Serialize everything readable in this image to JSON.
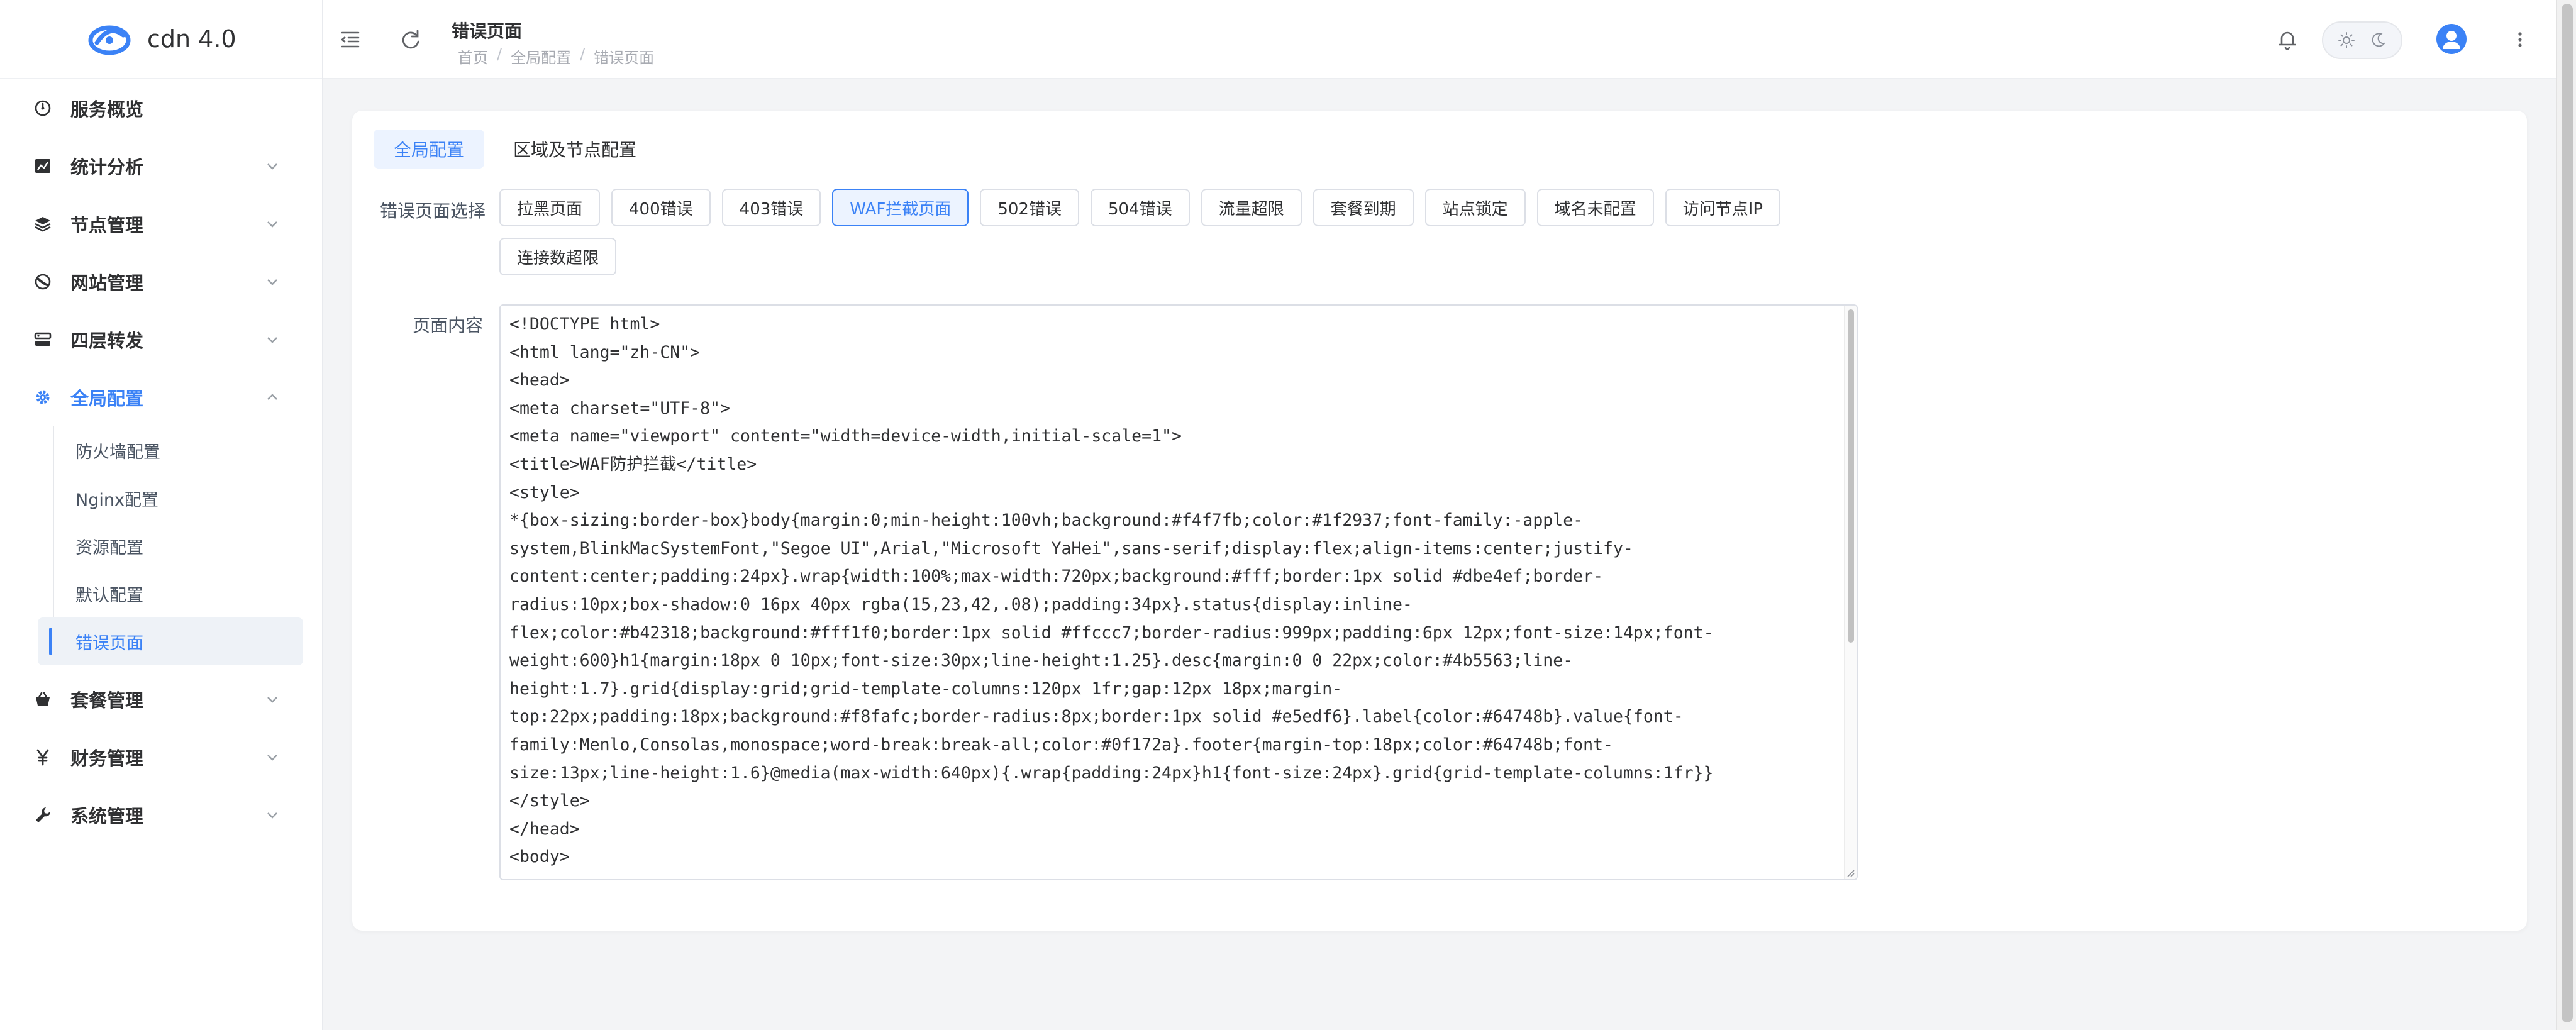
{
  "app": {
    "name": "cdn 4.0"
  },
  "sidebar": {
    "items": [
      {
        "label": "服务概览",
        "icon": "dashboard-icon",
        "has_children": false
      },
      {
        "label": "统计分析",
        "icon": "chart-icon",
        "has_children": true
      },
      {
        "label": "节点管理",
        "icon": "layers-icon",
        "has_children": true
      },
      {
        "label": "网站管理",
        "icon": "globe-icon",
        "has_children": true
      },
      {
        "label": "四层转发",
        "icon": "server-icon",
        "has_children": true
      },
      {
        "label": "全局配置",
        "icon": "gear-icon",
        "has_children": true,
        "expanded": true,
        "children": [
          {
            "label": "防火墙配置"
          },
          {
            "label": "Nginx配置"
          },
          {
            "label": "资源配置"
          },
          {
            "label": "默认配置"
          },
          {
            "label": "错误页面",
            "active": true
          }
        ]
      },
      {
        "label": "套餐管理",
        "icon": "basket-icon",
        "has_children": true
      },
      {
        "label": "财务管理",
        "icon": "yen-icon",
        "has_children": true
      },
      {
        "label": "系统管理",
        "icon": "wrench-icon",
        "has_children": true
      }
    ]
  },
  "header": {
    "title": "错误页面",
    "breadcrumb": [
      "首页",
      "全局配置",
      "错误页面"
    ],
    "separator": "/"
  },
  "tabs": [
    {
      "label": "全局配置",
      "active": true
    },
    {
      "label": "区域及节点配置",
      "active": false
    }
  ],
  "form": {
    "error_page_label": "错误页面选择",
    "content_label": "页面内容",
    "error_pages": [
      {
        "label": "拉黑页面",
        "active": false
      },
      {
        "label": "400错误",
        "active": false
      },
      {
        "label": "403错误",
        "active": false
      },
      {
        "label": "WAF拦截页面",
        "active": true
      },
      {
        "label": "502错误",
        "active": false
      },
      {
        "label": "504错误",
        "active": false
      },
      {
        "label": "流量超限",
        "active": false
      },
      {
        "label": "套餐到期",
        "active": false
      },
      {
        "label": "站点锁定",
        "active": false
      },
      {
        "label": "域名未配置",
        "active": false
      },
      {
        "label": "访问节点IP",
        "active": false
      },
      {
        "label": "连接数超限",
        "active": false
      }
    ],
    "code_lines": [
      "<!DOCTYPE html>",
      "<html lang=\"zh-CN\">",
      "<head>",
      "<meta charset=\"UTF-8\">",
      "<meta name=\"viewport\" content=\"width=device-width,initial-scale=1\">",
      "<title>WAF防护拦截</title>",
      "<style>",
      "*{box-sizing:border-box}body{margin:0;min-height:100vh;background:#f4f7fb;color:#1f2937;font-family:-apple-",
      "system,BlinkMacSystemFont,\"Segoe UI\",Arial,\"Microsoft YaHei\",sans-serif;display:flex;align-items:center;justify-",
      "content:center;padding:24px}.wrap{width:100%;max-width:720px;background:#fff;border:1px solid #dbe4ef;border-",
      "radius:10px;box-shadow:0 16px 40px rgba(15,23,42,.08);padding:34px}.status{display:inline-",
      "flex;color:#b42318;background:#fff1f0;border:1px solid #ffccc7;border-radius:999px;padding:6px 12px;font-size:14px;font-",
      "weight:600}h1{margin:18px 0 10px;font-size:30px;line-height:1.25}.desc{margin:0 0 22px;color:#4b5563;line-",
      "height:1.7}.grid{display:grid;grid-template-columns:120px 1fr;gap:12px 18px;margin-",
      "top:22px;padding:18px;background:#f8fafc;border-radius:8px;border:1px solid #e5edf6}.label{color:#64748b}.value{font-",
      "family:Menlo,Consolas,monospace;word-break:break-all;color:#0f172a}.footer{margin-top:18px;color:#64748b;font-",
      "size:13px;line-height:1.6}@media(max-width:640px){.wrap{padding:24px}h1{font-size:24px}.grid{grid-template-columns:1fr}}",
      "</style>",
      "</head>",
      "<body>"
    ]
  },
  "colors": {
    "accent": "#3b82f6",
    "accent_bg": "#ecf3ff",
    "page_bg": "#f3f4f6"
  }
}
